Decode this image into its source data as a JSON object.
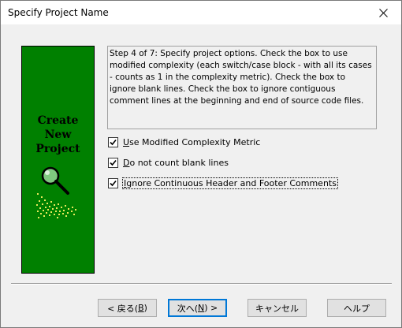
{
  "window": {
    "title": "Specify Project Name"
  },
  "banner": {
    "lines": [
      "Create",
      "New",
      "Project"
    ]
  },
  "description": "Step 4 of 7: Specify project options. Check the box to use modified complexity (each switch/case block - with all its cases - counts as 1 in the complexity metric). Check the box to ignore blank lines. Check the box to ignore contiguous comment lines at the beginning and end of source code files.",
  "options": [
    {
      "label": "Use Modified Complexity Metric",
      "mnemonic": "U",
      "checked": true
    },
    {
      "label": "Do not count blank lines",
      "mnemonic": "D",
      "checked": true
    },
    {
      "label": "Ignore Continuous Header and Footer Comments",
      "mnemonic": "I",
      "checked": true
    }
  ],
  "buttons": {
    "back": {
      "pre": "< 戻る(",
      "key": "B",
      "post": ")"
    },
    "next": {
      "pre": "次へ(",
      "key": "N",
      "post": ") >"
    },
    "cancel": "キャンセル",
    "help": "ヘルプ"
  },
  "colors": {
    "banner": "#008000",
    "dialog_bg": "#f0f0f0",
    "default_button_border": "#0078d7"
  }
}
